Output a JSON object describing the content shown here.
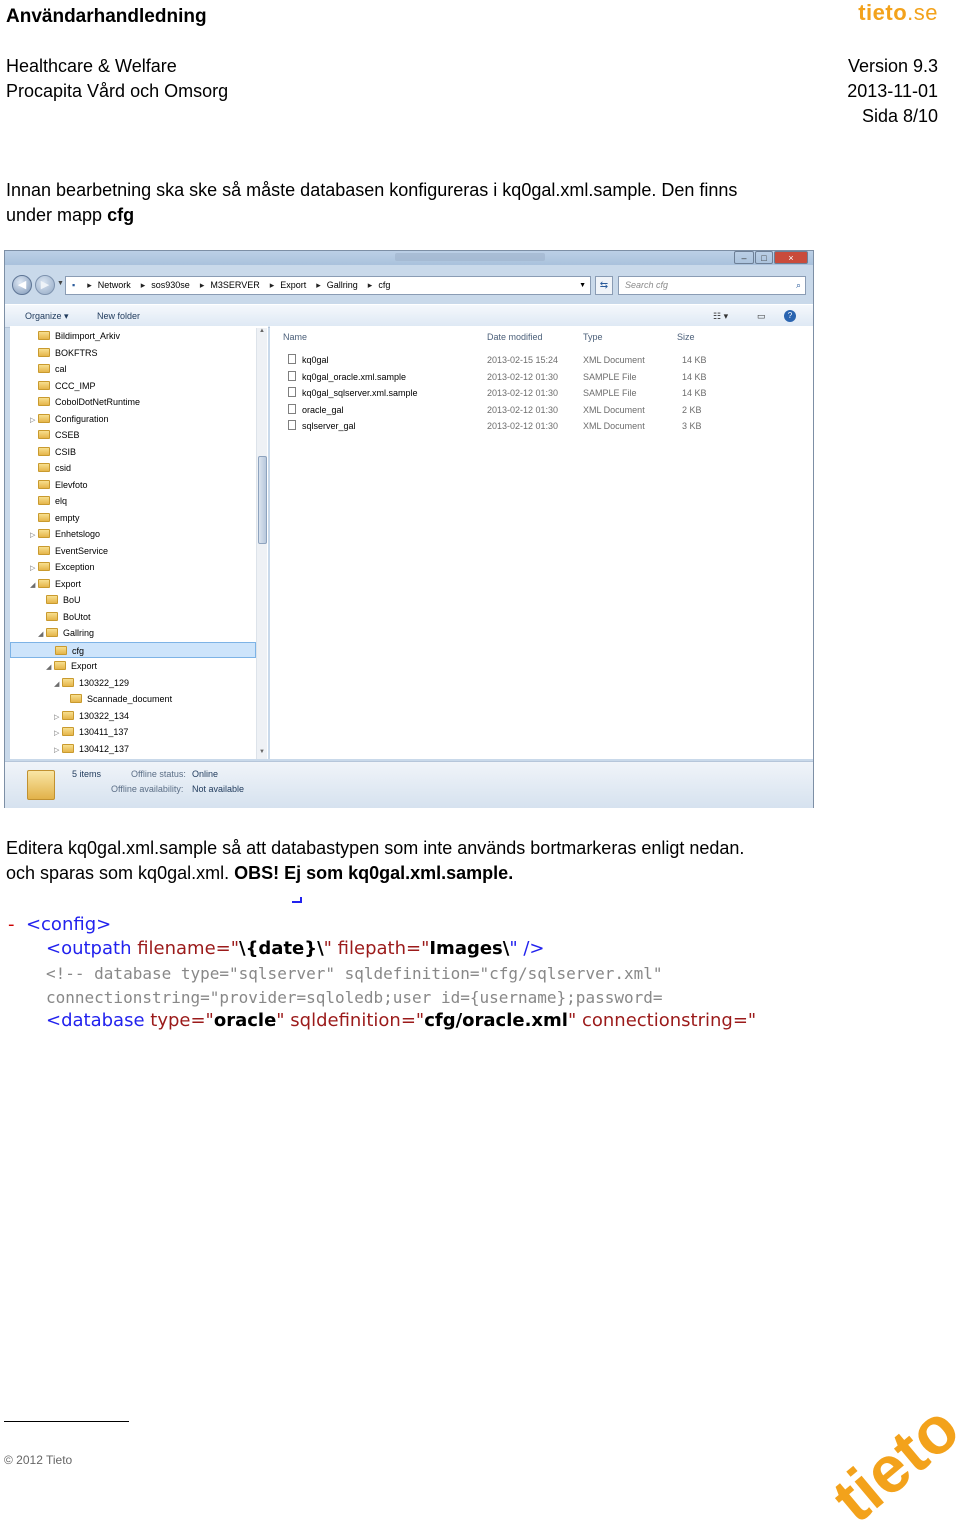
{
  "header": {
    "doc_title": "Användarhandledning",
    "logo": "tieto",
    "logo_suffix": ".se",
    "org": "Healthcare & Welfare",
    "product": "Procapita Vård och Omsorg",
    "version": "Version 9.3",
    "date": "2013-11-01",
    "page": "Sida 8/10"
  },
  "intro": {
    "line1": "Innan bearbetning ska ske så måste databasen konfigureras i kq0gal.xml.sample.  Den finns",
    "line2_text": "under mapp ",
    "line2_bold": "cfg"
  },
  "explorer": {
    "controls": [
      "–",
      "□",
      "×"
    ],
    "breadcrumb": [
      "Network",
      "sos930se",
      "M3SERVER",
      "Export",
      "Gallring",
      "cfg"
    ],
    "search_placeholder": "Search cfg",
    "toolbar": {
      "organize": "Organize ▾",
      "new_folder": "New folder"
    },
    "tree": [
      {
        "label": "Bildimport_Arkiv",
        "indent": 0,
        "arrow": ""
      },
      {
        "label": "BOKFTRS",
        "indent": 0,
        "arrow": ""
      },
      {
        "label": "cal",
        "indent": 0,
        "arrow": ""
      },
      {
        "label": "CCC_IMP",
        "indent": 0,
        "arrow": ""
      },
      {
        "label": "CobolDotNetRuntime",
        "indent": 0,
        "arrow": ""
      },
      {
        "label": "Configuration",
        "indent": 0,
        "arrow": "▷"
      },
      {
        "label": "CSEB",
        "indent": 0,
        "arrow": ""
      },
      {
        "label": "CSIB",
        "indent": 0,
        "arrow": ""
      },
      {
        "label": "csid",
        "indent": 0,
        "arrow": ""
      },
      {
        "label": "Elevfoto",
        "indent": 0,
        "arrow": ""
      },
      {
        "label": "elq",
        "indent": 0,
        "arrow": ""
      },
      {
        "label": "empty",
        "indent": 0,
        "arrow": ""
      },
      {
        "label": "Enhetslogo",
        "indent": 0,
        "arrow": "▷"
      },
      {
        "label": "EventService",
        "indent": 0,
        "arrow": ""
      },
      {
        "label": "Exception",
        "indent": 0,
        "arrow": "▷"
      },
      {
        "label": "Export",
        "indent": 0,
        "arrow": "◢"
      },
      {
        "label": "BoU",
        "indent": 1,
        "arrow": ""
      },
      {
        "label": "BoUtot",
        "indent": 1,
        "arrow": ""
      },
      {
        "label": "Gallring",
        "indent": 1,
        "arrow": "◢"
      },
      {
        "label": "cfg",
        "indent": 2,
        "arrow": "",
        "selected": true
      },
      {
        "label": "Export",
        "indent": 2,
        "arrow": "◢"
      },
      {
        "label": "130322_129",
        "indent": 3,
        "arrow": "◢"
      },
      {
        "label": "Scannade_document",
        "indent": 4,
        "arrow": ""
      },
      {
        "label": "130322_134",
        "indent": 3,
        "arrow": "▷"
      },
      {
        "label": "130411_137",
        "indent": 3,
        "arrow": "▷"
      },
      {
        "label": "130412_137",
        "indent": 3,
        "arrow": "▷"
      }
    ],
    "columns": {
      "name": "Name",
      "date": "Date modified",
      "type": "Type",
      "size": "Size"
    },
    "files": [
      {
        "name": "kq0gal",
        "date": "2013-02-15 15:24",
        "type": "XML Document",
        "size": "14 KB"
      },
      {
        "name": "kq0gal_oracle.xml.sample",
        "date": "2013-02-12 01:30",
        "type": "SAMPLE File",
        "size": "14 KB"
      },
      {
        "name": "kq0gal_sqlserver.xml.sample",
        "date": "2013-02-12 01:30",
        "type": "SAMPLE File",
        "size": "14 KB"
      },
      {
        "name": "oracle_gal",
        "date": "2013-02-12 01:30",
        "type": "XML Document",
        "size": "2 KB"
      },
      {
        "name": "sqlserver_gal",
        "date": "2013-02-12 01:30",
        "type": "XML Document",
        "size": "3 KB"
      }
    ],
    "status": {
      "items": "5 items",
      "offline_status_label": "Offline status:",
      "offline_status": "Online",
      "offline_avail_label": "Offline availability:",
      "offline_avail": "Not available"
    }
  },
  "edit_text": {
    "line1": "Editera kq0gal.xml.sample så att databastypen som inte används bortmarkeras enligt nedan.",
    "line2_text": "och sparas som kq0gal.xml.  ",
    "line2_bold": "OBS! Ej som kq0gal.xml.sample."
  },
  "code": {
    "l1_dash": "-",
    "l1_tag": "<config>",
    "l2_a": "<outpath",
    "l2_b": " filename=\"",
    "l2_c": "\\{date}\\",
    "l2_d": "\" filepath=\"",
    "l2_e": "Images\\",
    "l2_f": "\" />",
    "l3": "<!-- database type=\"sqlserver\" sqldefinition=\"cfg/sqlserver.xml\"",
    "l4": "connectionstring=\"provider=sqloledb;user id={username};password=",
    "l5_a": "<database",
    "l5_b": " type=\"",
    "l5_c": "oracle",
    "l5_d": "\" sqldefinition=\"",
    "l5_e": "cfg/oracle.xml",
    "l5_f": "\" connectionstring=\""
  },
  "footer": {
    "copyright": "© 2012 Tieto"
  },
  "colors": {
    "accent": "#f3a21b"
  }
}
